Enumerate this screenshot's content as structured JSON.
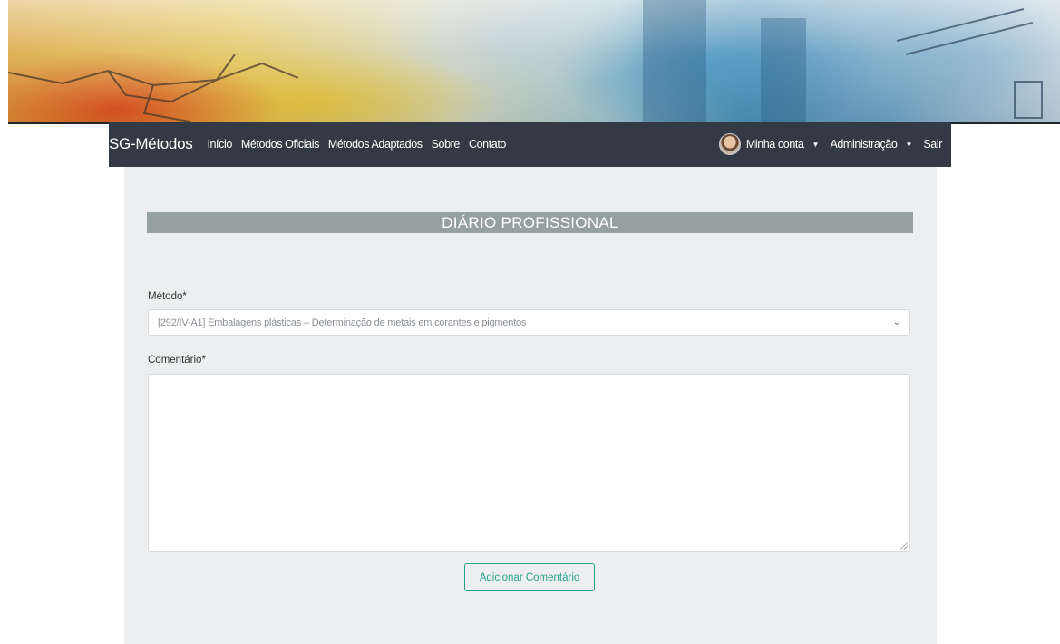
{
  "navbar": {
    "brand": "SG-Métodos",
    "links": [
      "Início",
      "Métodos Oficiais",
      "Métodos Adaptados",
      "Sobre",
      "Contato"
    ],
    "account": "Minha conta",
    "admin": "Administração",
    "logout": "Sair"
  },
  "page": {
    "heading": "DIÁRIO PROFISSIONAL"
  },
  "form": {
    "method_label": "Método*",
    "method_value": "[292/IV-A1] Embalagens plásticas – Determinação de metais em corantes e pigmentos",
    "comment_label": "Comentário*",
    "comment_value": "",
    "submit_label": "Adicionar Comentário"
  },
  "colors": {
    "navbar_bg": "#343a45",
    "heading_bar": "#95a0a0",
    "panel_bg": "#eceeef",
    "accent": "#28a38a"
  },
  "icons": {
    "caret": "caret-down-icon",
    "select": "chevron-down-icon",
    "avatar": "user-avatar"
  }
}
